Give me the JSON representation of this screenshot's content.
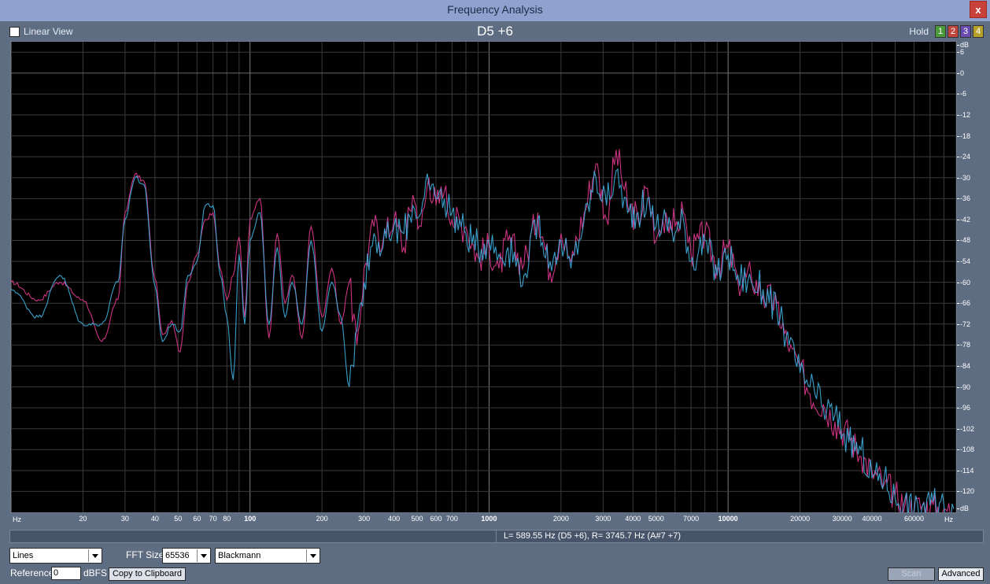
{
  "window": {
    "title": "Frequency Analysis",
    "close_label": "x"
  },
  "toolbar": {
    "linear_view_label": "Linear View",
    "linear_view_checked": false,
    "note": "D5 +6",
    "hold_label": "Hold",
    "hold_buttons": [
      {
        "label": "1",
        "color": "#4a9a3a"
      },
      {
        "label": "2",
        "color": "#c0453c"
      },
      {
        "label": "3",
        "color": "#6a4ab0"
      },
      {
        "label": "4",
        "color": "#b9a22a"
      }
    ]
  },
  "chart_data": {
    "type": "line",
    "xscale": "log",
    "xlim": [
      10,
      90000
    ],
    "ylim": [
      -126,
      9
    ],
    "y_unit": "dB",
    "x_unit": "Hz",
    "grid": true,
    "y_ticks": [
      "dB",
      "6",
      "0",
      "-6",
      "-12",
      "-18",
      "-24",
      "-30",
      "-36",
      "-42",
      "-48",
      "-54",
      "-60",
      "-66",
      "-72",
      "-78",
      "-84",
      "-90",
      "-96",
      "-102",
      "-108",
      "-114",
      "-120",
      "dB"
    ],
    "x_ticks": [
      {
        "f": 20,
        "label": "20",
        "major": false
      },
      {
        "f": 30,
        "label": "30",
        "major": false
      },
      {
        "f": 40,
        "label": "40",
        "major": false
      },
      {
        "f": 50,
        "label": "50",
        "major": false
      },
      {
        "f": 60,
        "label": "60",
        "major": false
      },
      {
        "f": 70,
        "label": "70",
        "major": false
      },
      {
        "f": 80,
        "label": "80",
        "major": false
      },
      {
        "f": 100,
        "label": "100",
        "major": true
      },
      {
        "f": 200,
        "label": "200",
        "major": false
      },
      {
        "f": 300,
        "label": "300",
        "major": false
      },
      {
        "f": 400,
        "label": "400",
        "major": false
      },
      {
        "f": 500,
        "label": "500",
        "major": false
      },
      {
        "f": 600,
        "label": "600",
        "major": false
      },
      {
        "f": 700,
        "label": "700",
        "major": false
      },
      {
        "f": 1000,
        "label": "1000",
        "major": true
      },
      {
        "f": 2000,
        "label": "2000",
        "major": false
      },
      {
        "f": 3000,
        "label": "3000",
        "major": false
      },
      {
        "f": 4000,
        "label": "4000",
        "major": false
      },
      {
        "f": 5000,
        "label": "5000",
        "major": false
      },
      {
        "f": 7000,
        "label": "7000",
        "major": false
      },
      {
        "f": 10000,
        "label": "10000",
        "major": true
      },
      {
        "f": 20000,
        "label": "20000",
        "major": false
      },
      {
        "f": 30000,
        "label": "30000",
        "major": false
      },
      {
        "f": 40000,
        "label": "40000",
        "major": false
      },
      {
        "f": 60000,
        "label": "60000",
        "major": false
      }
    ],
    "x_unit_left": "Hz",
    "x_unit_right": "Hz",
    "series": [
      {
        "color": "#e0398f",
        "x": [
          10,
          13,
          16,
          20,
          24,
          28,
          30,
          33,
          36,
          40,
          43,
          47,
          51,
          55,
          60,
          65,
          70,
          75,
          80,
          85,
          90,
          95,
          100,
          110,
          120,
          130,
          140,
          150,
          165,
          180,
          200,
          220,
          240,
          260,
          280,
          300,
          330,
          360,
          400,
          440,
          480,
          520,
          560,
          600,
          650,
          700,
          800,
          900,
          1000,
          1100,
          1200,
          1400,
          1600,
          1800,
          2000,
          2200,
          2500,
          2800,
          3100,
          3400,
          3800,
          4200,
          4600,
          5000,
          5500,
          6000,
          6500,
          7000,
          8000,
          9000,
          10000,
          11000,
          12500,
          14000,
          16000,
          18000,
          20000,
          22000,
          25000,
          28000,
          32000,
          36000,
          40000,
          45000,
          50000,
          55000,
          60000,
          65000,
          70000,
          80000,
          88000
        ],
        "values": [
          -60,
          -65,
          -60,
          -65,
          -77,
          -65,
          -40,
          -29,
          -31,
          -59,
          -75,
          -71,
          -80,
          -60,
          -52,
          -42,
          -40,
          -56,
          -65,
          -58,
          -47,
          -70,
          -42,
          -36,
          -76,
          -46,
          -66,
          -58,
          -76,
          -44,
          -70,
          -56,
          -72,
          -60,
          -78,
          -56,
          -44,
          -48,
          -42,
          -50,
          -35,
          -44,
          -30,
          -38,
          -34,
          -42,
          -44,
          -53,
          -50,
          -56,
          -48,
          -55,
          -40,
          -57,
          -46,
          -54,
          -40,
          -26,
          -42,
          -22,
          -38,
          -42,
          -33,
          -48,
          -40,
          -44,
          -40,
          -52,
          -46,
          -56,
          -50,
          -60,
          -58,
          -64,
          -66,
          -80,
          -84,
          -92,
          -95,
          -100,
          -104,
          -110,
          -114,
          -118,
          -121,
          -124,
          -125,
          -124,
          -125,
          -125,
          -126
        ]
      },
      {
        "color": "#3fb0e0",
        "x": [
          10,
          13,
          16,
          20,
          24,
          28,
          30,
          33,
          36,
          40,
          43,
          47,
          51,
          55,
          60,
          65,
          70,
          75,
          80,
          85,
          90,
          95,
          100,
          110,
          120,
          130,
          140,
          150,
          165,
          180,
          200,
          220,
          240,
          260,
          280,
          300,
          330,
          360,
          400,
          440,
          480,
          520,
          560,
          600,
          650,
          700,
          800,
          900,
          1000,
          1100,
          1200,
          1400,
          1600,
          1800,
          2000,
          2200,
          2500,
          2800,
          3100,
          3400,
          3800,
          4200,
          4600,
          5000,
          5500,
          6000,
          6500,
          7000,
          8000,
          9000,
          10000,
          11000,
          12500,
          14000,
          16000,
          18000,
          20000,
          22000,
          25000,
          28000,
          32000,
          36000,
          40000,
          45000,
          50000,
          55000,
          60000,
          65000,
          70000,
          80000,
          88000
        ],
        "values": [
          -62,
          -70,
          -58,
          -72,
          -72,
          -60,
          -42,
          -30,
          -32,
          -61,
          -77,
          -72,
          -74,
          -58,
          -54,
          -38,
          -38,
          -58,
          -70,
          -88,
          -52,
          -72,
          -48,
          -40,
          -72,
          -50,
          -70,
          -60,
          -72,
          -48,
          -74,
          -60,
          -70,
          -90,
          -74,
          -60,
          -46,
          -50,
          -44,
          -46,
          -38,
          -40,
          -32,
          -36,
          -36,
          -40,
          -46,
          -50,
          -48,
          -52,
          -50,
          -58,
          -42,
          -54,
          -48,
          -56,
          -42,
          -30,
          -38,
          -28,
          -40,
          -40,
          -36,
          -44,
          -42,
          -46,
          -42,
          -54,
          -48,
          -58,
          -52,
          -58,
          -60,
          -62,
          -68,
          -78,
          -86,
          -90,
          -96,
          -98,
          -106,
          -108,
          -116,
          -116,
          -122,
          -122,
          -126,
          -124,
          -124,
          -124,
          -125
        ]
      }
    ]
  },
  "status": {
    "readout": "L= 589.55 Hz (D5 +6), R= 3745.7 Hz (A#7 +7)"
  },
  "controls": {
    "display_mode": "Lines",
    "fft_size_label": "FFT Size",
    "fft_size": "65536",
    "window_function": "Blackmann",
    "reference_label": "Reference",
    "reference_value": "0",
    "reference_unit": "dBFS",
    "copy_label": "Copy to Clipboard",
    "scan_label": "Scan",
    "advanced_label": "Advanced"
  }
}
